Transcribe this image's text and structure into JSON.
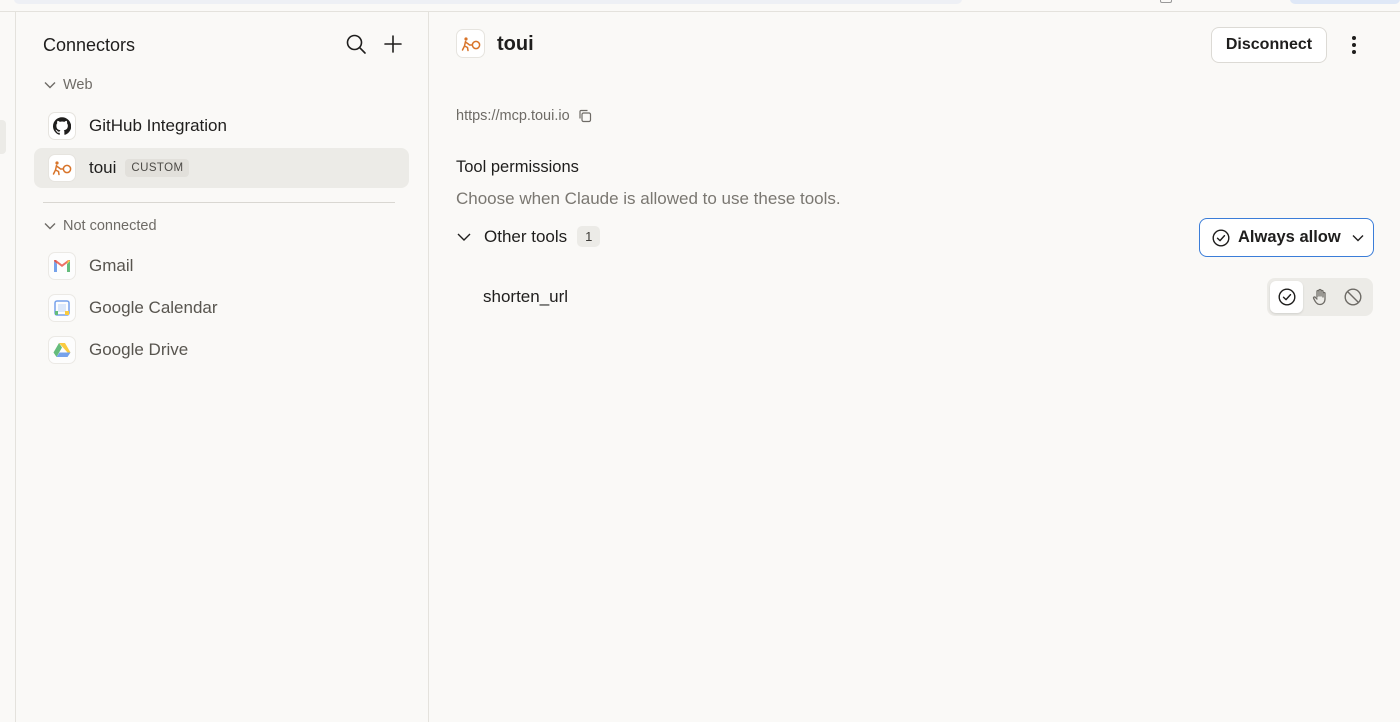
{
  "sidebar": {
    "title": "Connectors",
    "sections": [
      {
        "label": "Web",
        "items": [
          {
            "label": "GitHub Integration",
            "icon": "github-icon"
          },
          {
            "label": "toui",
            "icon": "toui-icon",
            "badge": "CUSTOM",
            "active": true
          }
        ]
      },
      {
        "label": "Not connected",
        "items": [
          {
            "label": "Gmail",
            "icon": "gmail-icon"
          },
          {
            "label": "Google Calendar",
            "icon": "google-calendar-icon"
          },
          {
            "label": "Google Drive",
            "icon": "google-drive-icon"
          }
        ]
      }
    ]
  },
  "main": {
    "title": "toui",
    "disconnect_label": "Disconnect",
    "url": "https://mcp.toui.io",
    "permissions_title": "Tool permissions",
    "permissions_desc": "Choose when Claude is allowed to use these tools.",
    "group": {
      "label": "Other tools",
      "count": "1",
      "selected_permission": "Always allow"
    },
    "tools": [
      {
        "name": "shorten_url",
        "permission": "always-allow"
      }
    ]
  },
  "colors": {
    "accent": "#3b7dd8",
    "toui_brand": "#d8742a",
    "background": "#faf9f7"
  }
}
